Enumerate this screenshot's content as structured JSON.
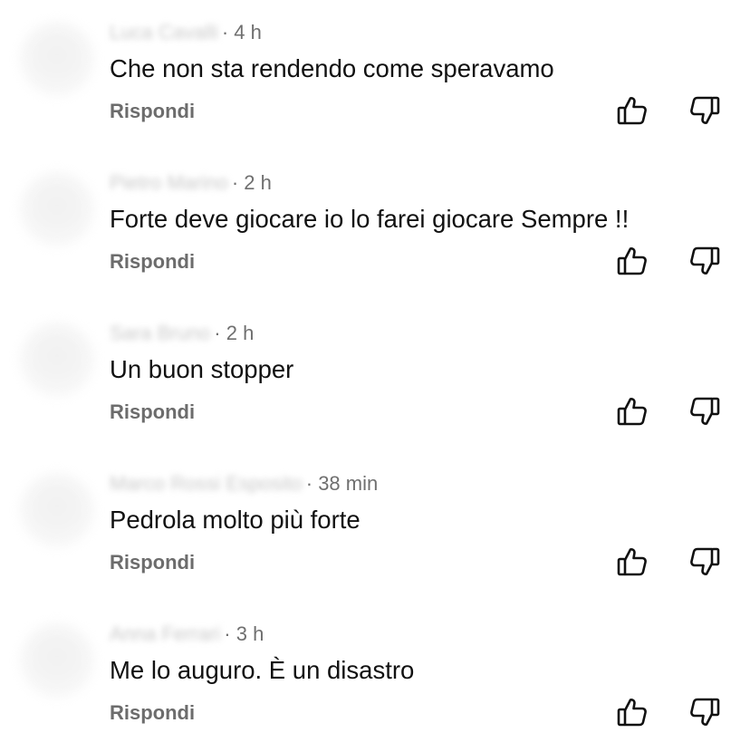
{
  "comments": [
    {
      "author": "Luca Cavalli",
      "time": "· 4 h",
      "text": "Che non sta rendendo come speravamo",
      "reply_label": "Rispondi"
    },
    {
      "author": "Pietro Marino",
      "time": "· 2 h",
      "text": "Forte deve giocare io lo farei giocare Sempre !!",
      "reply_label": "Rispondi"
    },
    {
      "author": "Sara Bruno",
      "time": "· 2 h",
      "text": "Un buon stopper",
      "reply_label": "Rispondi"
    },
    {
      "author": "Marco Rossi Esposito",
      "time": "· 38 min",
      "text": "Pedrola molto più forte",
      "reply_label": "Rispondi"
    },
    {
      "author": "Anna Ferrari",
      "time": "· 3 h",
      "text": "Me lo auguro. È un disastro",
      "reply_label": "Rispondi"
    }
  ],
  "icons": {
    "like": "thumb-up-icon",
    "dislike": "thumb-down-icon"
  },
  "colors": {
    "text": "#111111",
    "meta": "#6f6f6f",
    "reply": "#6c6c6c",
    "icon": "#111111"
  }
}
